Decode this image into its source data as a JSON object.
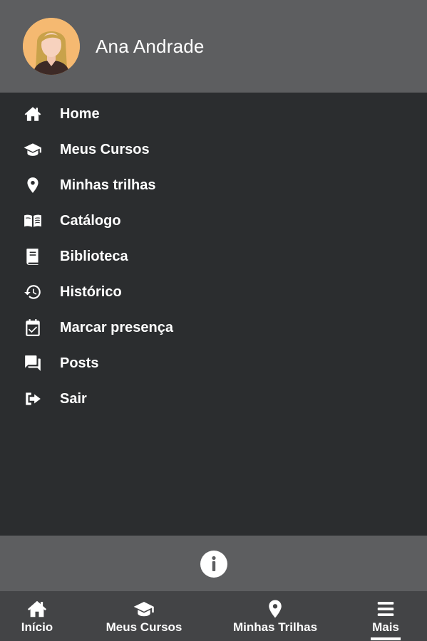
{
  "user": {
    "name": "Ana Andrade"
  },
  "menu": {
    "items": [
      {
        "label": "Home",
        "icon": "home-icon"
      },
      {
        "label": "Meus Cursos",
        "icon": "graduation-cap-icon"
      },
      {
        "label": "Minhas trilhas",
        "icon": "map-pin-icon"
      },
      {
        "label": "Catálogo",
        "icon": "open-book-icon"
      },
      {
        "label": "Biblioteca",
        "icon": "book-icon"
      },
      {
        "label": "Histórico",
        "icon": "history-icon"
      },
      {
        "label": "Marcar presença",
        "icon": "calendar-check-icon"
      },
      {
        "label": "Posts",
        "icon": "chat-bubbles-icon"
      },
      {
        "label": "Sair",
        "icon": "sign-out-icon"
      }
    ]
  },
  "bottom_nav": {
    "items": [
      {
        "label": "Início",
        "icon": "home-icon"
      },
      {
        "label": "Meus Cursos",
        "icon": "graduation-cap-icon"
      },
      {
        "label": "Minhas Trilhas",
        "icon": "map-pin-icon"
      },
      {
        "label": "Mais",
        "icon": "menu-icon",
        "active": true
      }
    ]
  },
  "colors": {
    "header_bg": "#5d5e60",
    "menu_bg": "#2b2d2f",
    "nav_bg": "#434446",
    "text": "#ffffff"
  }
}
